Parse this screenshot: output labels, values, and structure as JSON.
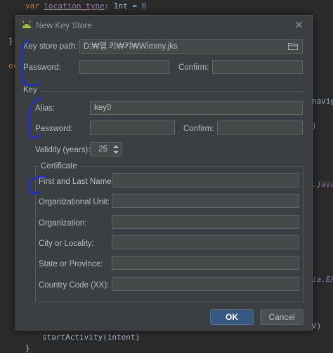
{
  "code": {
    "line_var_kw": "var",
    "line_var_name": "location_type",
    "line_var_type": ": Int = ",
    "line_var_value": "0",
    "brace_1": "}",
    "fragment_ov": "ov",
    "fragment_naviga": "naviga",
    "fragment_paren": ")",
    "fragment_java": ".java)",
    "fragment_ex": "ia.EX",
    "fragment_v": "V)",
    "start_activity": "startActivity(intent)",
    "brace_2": "}"
  },
  "dialog": {
    "title": "New Key Store",
    "close_glyph": "✕",
    "key_store_path_label": "Key store path:",
    "key_store_path_value": "D:₩앱 키₩키₩Wimmy.jks",
    "password_label": "Password:",
    "confirm_label": "Confirm:",
    "key_section_label": "Key",
    "alias_label": "Alias:",
    "alias_value": "key0",
    "key_password_label": "Password:",
    "key_confirm_label": "Confirm:",
    "validity_label": "Validity (years):",
    "validity_value": "25",
    "certificate_label": "Certificate",
    "cert_fields": [
      "First and Last Name:",
      "Organizational Unit:",
      "Organization:",
      "City or Locality:",
      "State or Province:",
      "Country Code (XX):"
    ],
    "ok_label": "OK",
    "cancel_label": "Cancel"
  },
  "colors": {
    "accent": "#365880",
    "android_green": "#a4c639",
    "annotation_blue": "#1c2fd0"
  }
}
